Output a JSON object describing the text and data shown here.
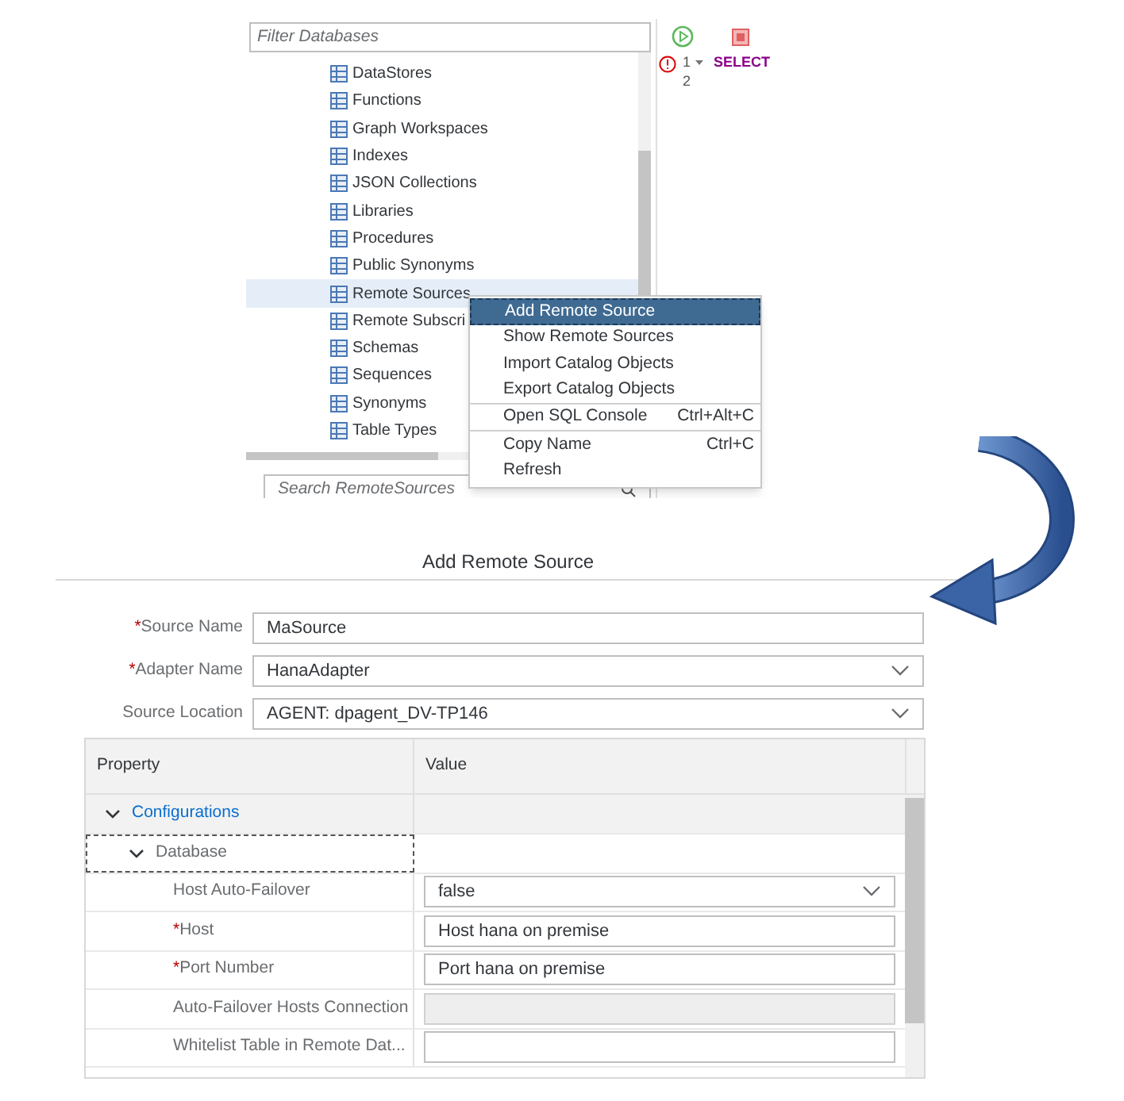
{
  "tree": {
    "filter_placeholder": "Filter Databases",
    "items": [
      {
        "label": "DataStores",
        "selected": false
      },
      {
        "label": "Functions",
        "selected": false
      },
      {
        "label": "Graph Workspaces",
        "selected": false
      },
      {
        "label": "Indexes",
        "selected": false
      },
      {
        "label": "JSON Collections",
        "selected": false
      },
      {
        "label": "Libraries",
        "selected": false
      },
      {
        "label": "Procedures",
        "selected": false
      },
      {
        "label": "Public Synonyms",
        "selected": false
      },
      {
        "label": "Remote Sources",
        "selected": true
      },
      {
        "label": "Remote Subscri",
        "selected": false
      },
      {
        "label": "Schemas",
        "selected": false
      },
      {
        "label": "Sequences",
        "selected": false
      },
      {
        "label": "Synonyms",
        "selected": false
      },
      {
        "label": "Table Types",
        "selected": false
      }
    ],
    "search_placeholder": "Search RemoteSources"
  },
  "editor": {
    "lines": [
      {
        "number": "1",
        "code": "SELECT",
        "error": true
      },
      {
        "number": "2",
        "error": false
      }
    ]
  },
  "context_menu": {
    "items": [
      {
        "label": "Add Remote Source",
        "selected": true,
        "divider_after": false
      },
      {
        "label": "Show Remote Sources",
        "selected": false,
        "divider_after": false
      },
      {
        "label": "Import Catalog Objects",
        "selected": false,
        "divider_after": false
      },
      {
        "label": "Export Catalog Objects",
        "selected": false,
        "divider_after": true
      },
      {
        "label": "Open SQL Console",
        "shortcut": "Ctrl+Alt+C",
        "selected": false,
        "divider_after": true
      },
      {
        "label": "Copy Name",
        "shortcut": "Ctrl+C",
        "selected": false,
        "divider_after": false
      },
      {
        "label": "Refresh",
        "selected": false,
        "divider_after": false
      }
    ]
  },
  "dialog": {
    "title": "Add Remote Source",
    "required_mark": "*",
    "fields": [
      {
        "label": "Source Name",
        "required": true,
        "kind": "text",
        "value": "MaSource"
      },
      {
        "label": "Adapter Name",
        "required": true,
        "kind": "dropdown",
        "value": "HanaAdapter"
      },
      {
        "label": "Source Location",
        "required": false,
        "kind": "dropdown",
        "value": "AGENT: dpagent_DV-TP146"
      }
    ],
    "properties": {
      "columns": [
        "Property",
        "Value"
      ],
      "groups": [
        {
          "label": "Configurations",
          "expanded": true,
          "focused": false,
          "children": [
            {
              "label": "Database",
              "expanded": true,
              "focused": true,
              "children": [
                {
                  "label": "Host Auto-Failover",
                  "required": false,
                  "kind": "dropdown",
                  "value": "false",
                  "disabled": false
                },
                {
                  "label": "Host",
                  "required": true,
                  "kind": "text",
                  "value": "Host hana on premise",
                  "disabled": false
                },
                {
                  "label": "Port Number",
                  "required": true,
                  "kind": "text",
                  "value": "Port hana on premise",
                  "disabled": false
                },
                {
                  "label": "Auto-Failover Hosts Connection",
                  "required": false,
                  "kind": "text",
                  "disabled": true
                },
                {
                  "label": "Whitelist Table in Remote Dat...",
                  "required": false,
                  "kind": "text",
                  "disabled": false
                }
              ]
            }
          ]
        }
      ]
    }
  }
}
